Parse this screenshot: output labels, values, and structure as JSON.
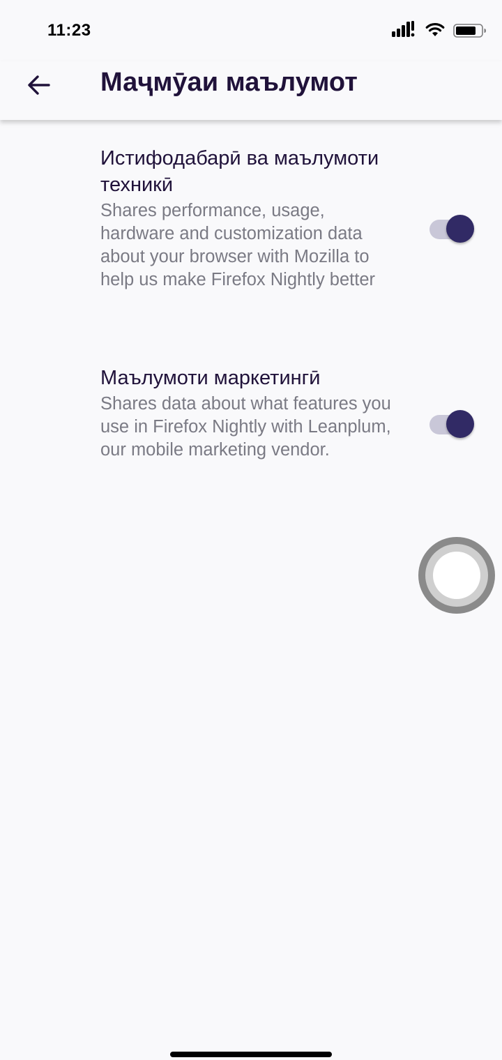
{
  "status_bar": {
    "time": "11:23",
    "icons": [
      "signal-icon",
      "wifi-icon",
      "battery-icon"
    ]
  },
  "app_bar": {
    "back_icon": "arrow-left-icon",
    "title": "Маҷмӯаи маълумот"
  },
  "preferences": [
    {
      "title": "Истифодабарӣ ва маълумоти техникӣ",
      "summary": "Shares performance, usage, hardware and customization data about your browser with Mozilla to help us make Firefox Nightly better",
      "enabled": true
    },
    {
      "title": "Маълумоти маркетингӣ",
      "summary": "Shares data about what features you use in Firefox Nightly with Leanplum, our mobile marketing vendor.",
      "enabled": true
    }
  ],
  "colors": {
    "background": "#f9f9fb",
    "primary_text": "#20123a",
    "secondary_text": "#7a7a84",
    "switch_thumb_on": "#312a65",
    "switch_track_on": "#c9c7d8"
  }
}
